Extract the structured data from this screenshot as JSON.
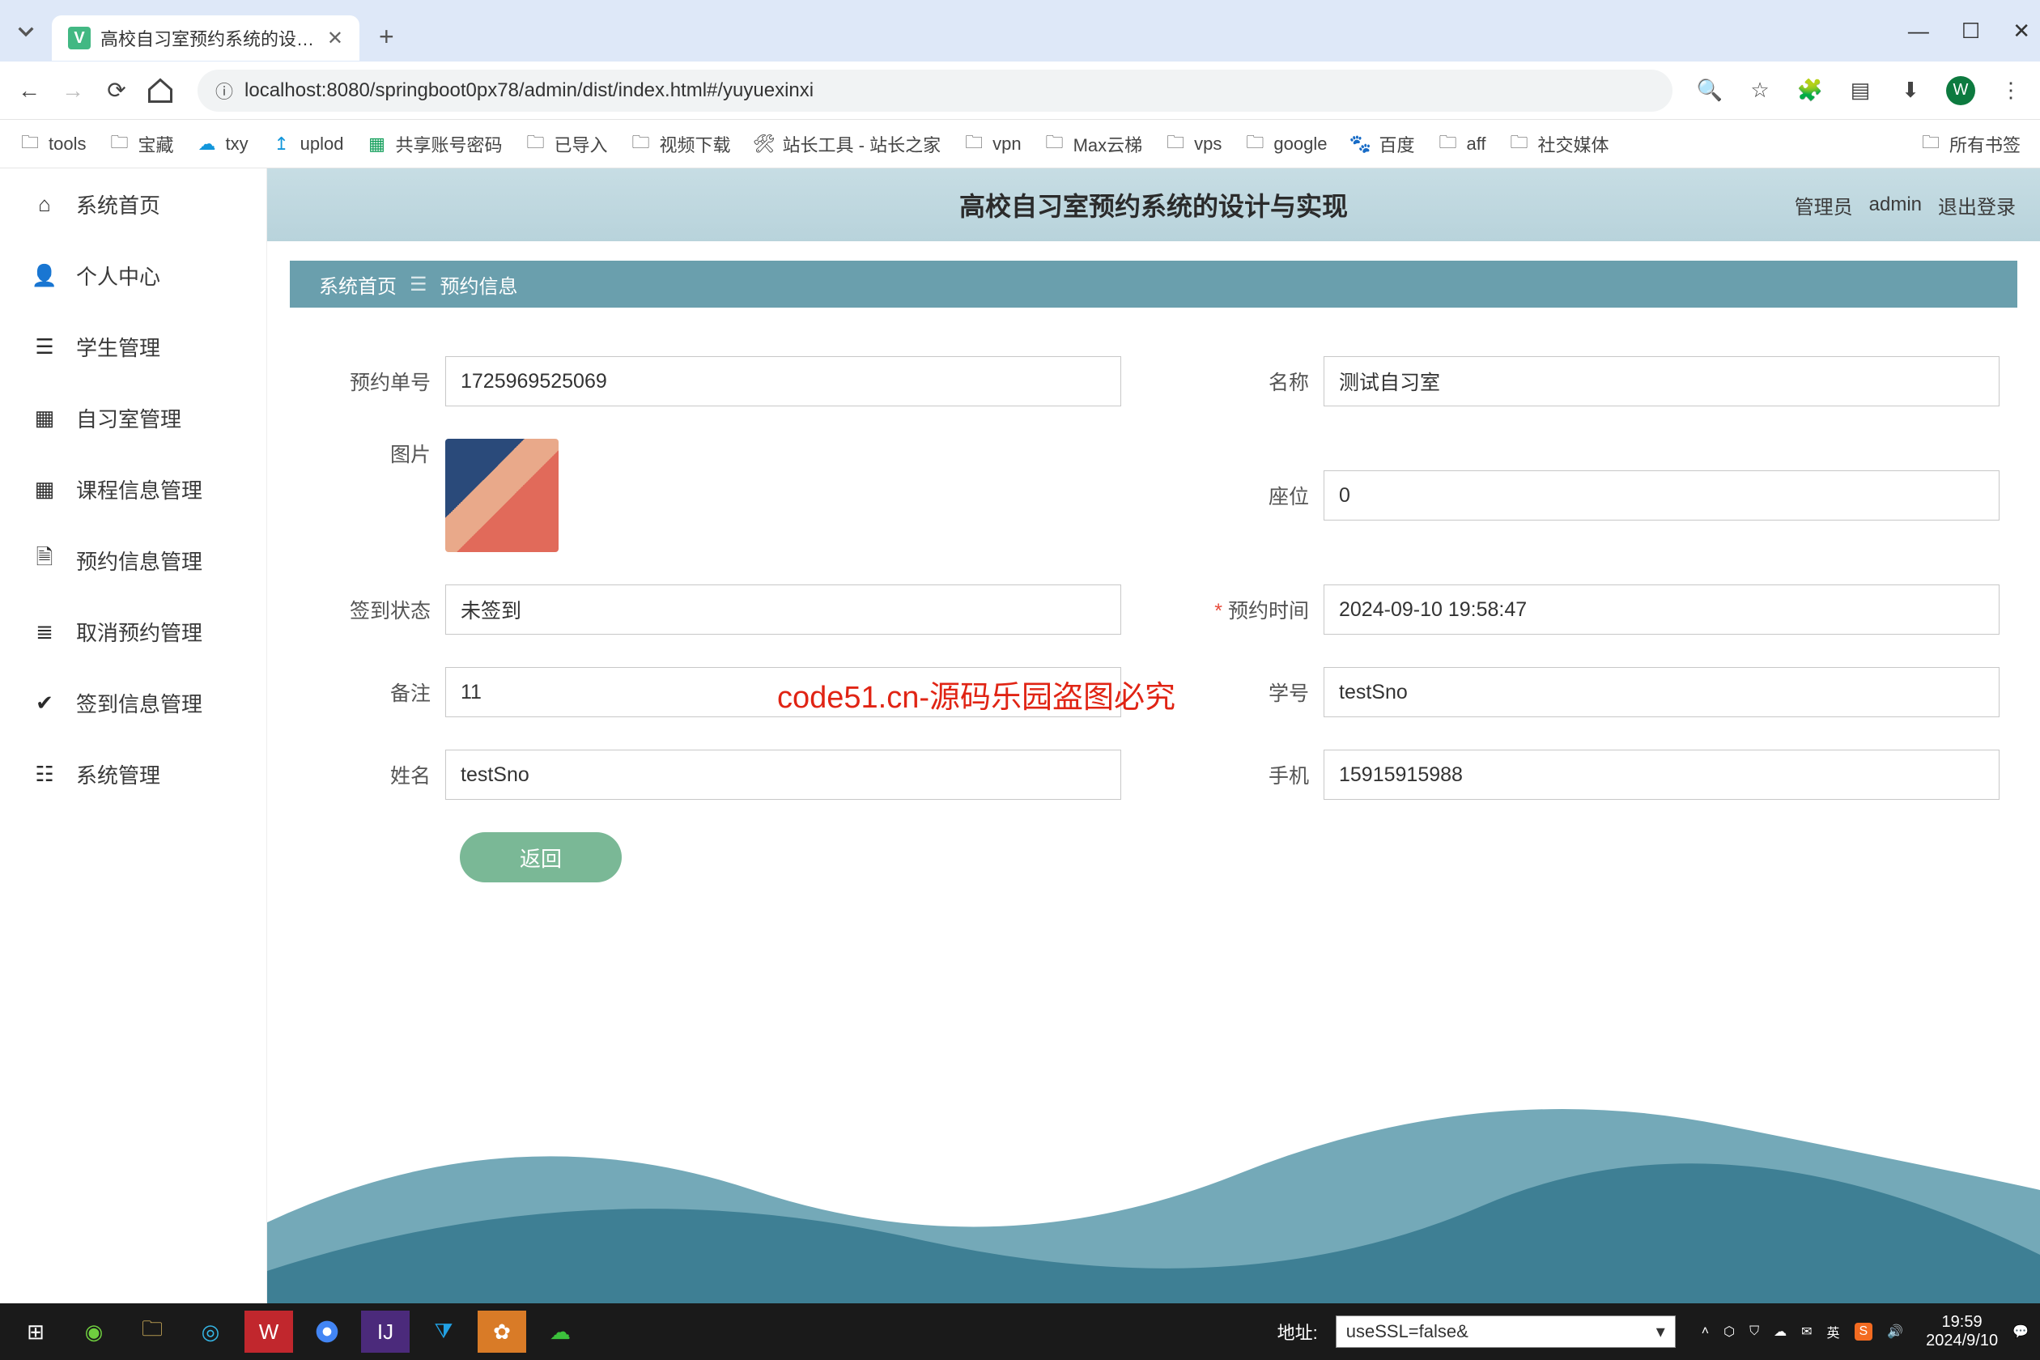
{
  "browser": {
    "tab_title": "高校自习室预约系统的设计与实",
    "url": "localhost:8080/springboot0px78/admin/dist/index.html#/yuyuexinxi",
    "profile_letter": "W",
    "bookmarks": [
      {
        "label": "tools",
        "icon": "folder"
      },
      {
        "label": "宝藏",
        "icon": "folder"
      },
      {
        "label": "txy",
        "icon": "cloud"
      },
      {
        "label": "uplod",
        "icon": "upload"
      },
      {
        "label": "共享账号密码",
        "icon": "sheet"
      },
      {
        "label": "已导入",
        "icon": "folder"
      },
      {
        "label": "视频下载",
        "icon": "folder"
      },
      {
        "label": "站长工具 - 站长之家",
        "icon": "tool"
      },
      {
        "label": "vpn",
        "icon": "folder"
      },
      {
        "label": "Max云梯",
        "icon": "folder"
      },
      {
        "label": "vps",
        "icon": "folder"
      },
      {
        "label": "google",
        "icon": "folder"
      },
      {
        "label": "百度",
        "icon": "paw"
      },
      {
        "label": "aff",
        "icon": "folder"
      },
      {
        "label": "社交媒体",
        "icon": "folder"
      }
    ],
    "all_bookmarks_label": "所有书签"
  },
  "sidebar": {
    "items": [
      {
        "label": "系统首页",
        "icon": "home"
      },
      {
        "label": "个人中心",
        "icon": "user"
      },
      {
        "label": "学生管理",
        "icon": "layers"
      },
      {
        "label": "自习室管理",
        "icon": "grid"
      },
      {
        "label": "课程信息管理",
        "icon": "grid2"
      },
      {
        "label": "预约信息管理",
        "icon": "doc"
      },
      {
        "label": "取消预约管理",
        "icon": "list"
      },
      {
        "label": "签到信息管理",
        "icon": "check"
      },
      {
        "label": "系统管理",
        "icon": "bars"
      }
    ]
  },
  "header": {
    "title": "高校自习室预约系统的设计与实现",
    "role": "管理员",
    "user": "admin",
    "logout": "退出登录"
  },
  "breadcrumb": {
    "home": "系统首页",
    "current": "预约信息"
  },
  "form": {
    "order_no_label": "预约单号",
    "order_no": "1725969525069",
    "name_label": "名称",
    "name": "测试自习室",
    "image_label": "图片",
    "seat_label": "座位",
    "seat": "0",
    "signin_label": "签到状态",
    "signin": "未签到",
    "time_label": "预约时间",
    "time": "2024-09-10 19:58:47",
    "remark_label": "备注",
    "remark": "11",
    "sno_label": "学号",
    "sno": "testSno",
    "sname_label": "姓名",
    "sname": "testSno",
    "phone_label": "手机",
    "phone": "15915915988",
    "back_btn": "返回"
  },
  "overlay": {
    "red_text": "code51.cn-源码乐园盗图必究"
  },
  "taskbar": {
    "addr_label": "地址:",
    "addr_value": "useSSL=false&",
    "ime_lang": "英",
    "clock_time": "19:59",
    "clock_date": "2024/9/10"
  }
}
